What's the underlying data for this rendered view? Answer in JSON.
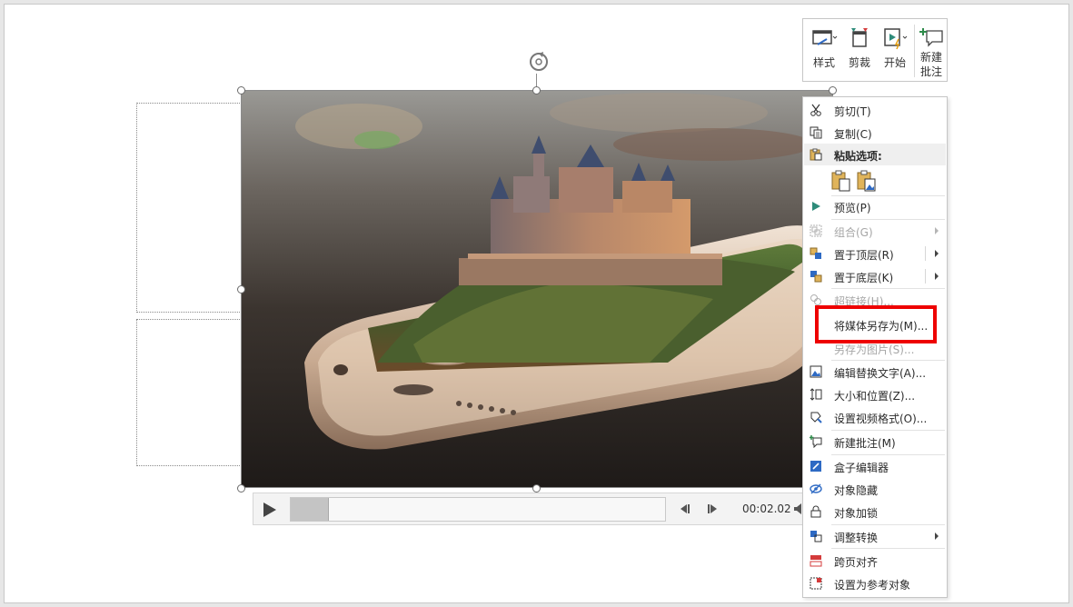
{
  "mini_toolbar": {
    "items": [
      {
        "label": "样式",
        "icon": "video-style-icon"
      },
      {
        "label": "剪裁",
        "icon": "trim-icon"
      },
      {
        "label": "开始",
        "icon": "start-icon"
      },
      {
        "label_line1": "新建",
        "label_line2": "批注",
        "icon": "new-comment-icon"
      }
    ]
  },
  "playbar": {
    "time": "00:02.02",
    "progress": 0.1
  },
  "context_menu": {
    "cut": "剪切(T)",
    "copy": "复制(C)",
    "paste_options": "粘贴选项:",
    "preview": "预览(P)",
    "group": "组合(G)",
    "bring_to_front": "置于顶层(R)",
    "send_to_back": "置于底层(K)",
    "hyperlink": "超链接(H)...",
    "save_media_as": "将媒体另存为(M)...",
    "save_as_picture": "另存为图片(S)...",
    "edit_alt_text": "编辑替换文字(A)...",
    "size_position": "大小和位置(Z)...",
    "format_video": "设置视频格式(O)...",
    "new_comment": "新建批注(M)",
    "box_editor": "盒子编辑器",
    "hide_object": "对象隐藏",
    "lock_object": "对象加锁",
    "adjust_convert": "调整转换",
    "cross_page_align": "跨页对齐",
    "set_reference": "设置为参考对象"
  },
  "colors": {
    "highlight": "#ee0000",
    "accent_teal": "#2e8b7a"
  }
}
